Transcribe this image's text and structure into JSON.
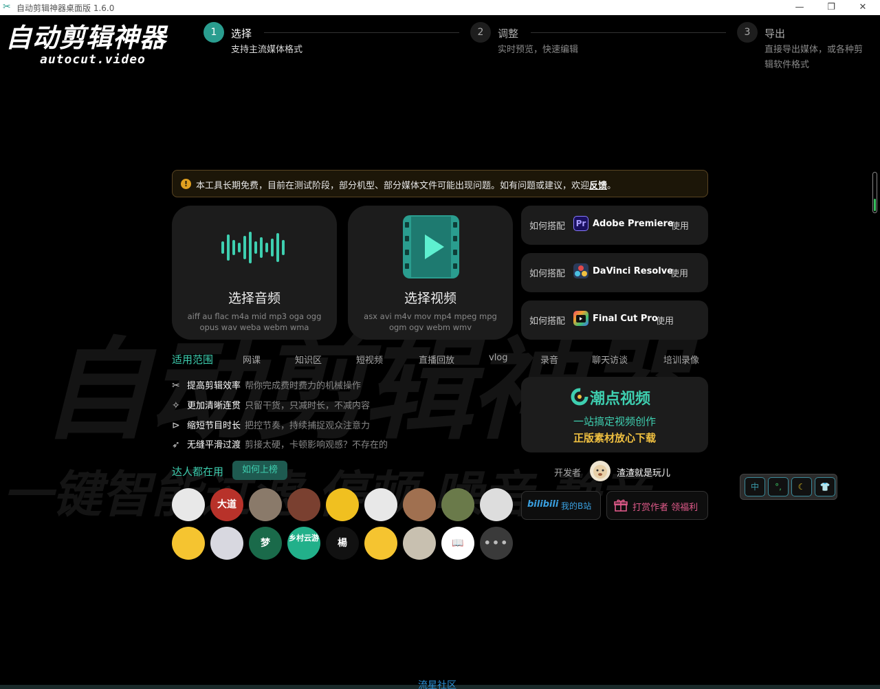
{
  "window": {
    "title": "自动剪辑神器桌面版 1.6.0",
    "controls": {
      "minimize": "—",
      "restore": "❐",
      "close": "✕"
    }
  },
  "logo": {
    "title": "自动剪辑神器",
    "subtitle": "autocut.video"
  },
  "steps": [
    {
      "num": "1",
      "title": "选择",
      "desc": "支持主流媒体格式"
    },
    {
      "num": "2",
      "title": "调整",
      "desc": "实时预览，快速编辑"
    },
    {
      "num": "3",
      "title": "导出",
      "desc": "直接导出媒体，或各种剪",
      "desc2": "辑软件格式"
    }
  ],
  "background": {
    "big": "自动剪辑神器",
    "row": "一键智能过滤 停顿 噪音 静音"
  },
  "notice": {
    "text": "本工具长期免费，目前在测试阶段，部分机型、部分媒体文件可能出现问题。如有问题或建议，欢迎",
    "link": "反馈",
    "end": "。"
  },
  "cards": {
    "audio": {
      "name": "选择音频",
      "formats": "aiff au flac m4a mid mp3 oga ogg opus wav weba webm wma"
    },
    "video": {
      "name": "选择视频",
      "formats": "asx avi m4v mov mp4 mpeg mpg ogm ogv webm wmv"
    }
  },
  "howto": [
    {
      "prefix": "如何搭配",
      "app": "Adobe Premiere",
      "suffix": "使用",
      "badge": "Pr"
    },
    {
      "prefix": "如何搭配",
      "app": "DaVinci Resolve",
      "suffix": "使用",
      "badge": ""
    },
    {
      "prefix": "如何搭配",
      "app": "Final Cut Pro",
      "suffix": "使用",
      "badge": ""
    }
  ],
  "scope": {
    "label": "适用范围",
    "items": [
      "网课",
      "知识区",
      "短视频",
      "直播回放",
      "vlog",
      "录音",
      "聊天访谈",
      "培训录像"
    ]
  },
  "features": [
    {
      "icon": "✂",
      "title": "提高剪辑效率",
      "desc": "帮你完成费时费力的机械操作"
    },
    {
      "icon": "✧",
      "title": "更加清晰连贯",
      "desc": "只留干货，只减时长，不减内容"
    },
    {
      "icon": "⊳",
      "title": "缩短节目时长",
      "desc": "把控节奏，持续捕捉观众注意力"
    },
    {
      "icon": "➶",
      "title": "无缝平滑过渡",
      "desc": "剪接太硬，卡顿影响观感？不存在的"
    }
  ],
  "promo": {
    "brand": "潮点视频",
    "line1": "一站搞定视频创作",
    "line2": "正版素材放心下载"
  },
  "users": {
    "label": "达人都在用",
    "button": "如何上榜",
    "more": "•••"
  },
  "developer": {
    "label": "开发者",
    "name": "渣渣就是玩儿"
  },
  "buttons": {
    "bili": "我的B站",
    "bili_logo": "bilibili",
    "tip": "打赏作者 领福利"
  },
  "ime": [
    "中",
    "°,",
    "☾",
    "👕"
  ],
  "avatars": [
    {
      "bg": "#e8e8e8",
      "fg": "#111",
      "t": ""
    },
    {
      "bg": "#b8322a",
      "fg": "#fff",
      "t": "大道"
    },
    {
      "bg": "#8a7a6a",
      "fg": "#fff",
      "t": ""
    },
    {
      "bg": "#7a4030",
      "fg": "#fff",
      "t": ""
    },
    {
      "bg": "#f0c020",
      "fg": "#c03020",
      "t": ""
    },
    {
      "bg": "#e8e8e8",
      "fg": "#333",
      "t": ""
    },
    {
      "bg": "#a07050",
      "fg": "#fff",
      "t": ""
    },
    {
      "bg": "#6a7a4a",
      "fg": "#fff",
      "t": ""
    },
    {
      "bg": "#dddddd",
      "fg": "#333",
      "t": ""
    },
    {
      "bg": "#f5c430",
      "fg": "#333",
      "t": ""
    },
    {
      "bg": "#d8d8e0",
      "fg": "#666",
      "t": ""
    },
    {
      "bg": "#1a6a4a",
      "fg": "#fff",
      "t": "梦"
    },
    {
      "bg": "#22b08a",
      "fg": "#fff",
      "t": "乡村云游"
    },
    {
      "bg": "#111111",
      "fg": "#fff",
      "t": "楊"
    },
    {
      "bg": "#f5c430",
      "fg": "#333",
      "t": ""
    },
    {
      "bg": "#c8c0b0",
      "fg": "#333",
      "t": ""
    },
    {
      "bg": "#ffffff",
      "fg": "#111",
      "t": "📖"
    }
  ],
  "footer": {
    "link": "流星社区"
  },
  "colors": {
    "accent": "#3ecfb0",
    "notice_border": "#5a4522",
    "link_blue": "#2a8fd6",
    "promo_yellow": "#f0c040"
  }
}
